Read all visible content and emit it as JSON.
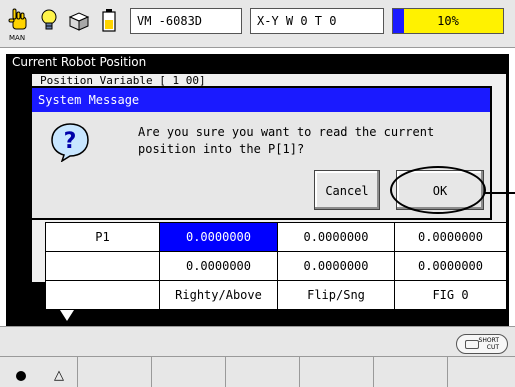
{
  "topbar": {
    "man_label": "MAN",
    "icons": [
      "hand-icon",
      "lightbulb-icon",
      "box-icon",
      "battery-icon"
    ],
    "program": "VM  -6083D",
    "coord_system": "X-Y  W 0 T 0",
    "speed_value": "10%",
    "speed_fraction": 0.1
  },
  "background_window": {
    "title": "Current Robot Position",
    "inner_title": "Position Variable [ 1 00]"
  },
  "dialog": {
    "title": "System Message",
    "icon": "question-icon",
    "message_line1": "Are you sure you want to read the current",
    "message_line2": "position into the P[1]?",
    "cancel_label": "Cancel",
    "ok_label": "OK"
  },
  "grid": {
    "rows": [
      [
        "P1",
        "0.0000000",
        "0.0000000",
        "0.0000000"
      ],
      [
        "",
        "0.0000000",
        "0.0000000",
        "0.0000000"
      ],
      [
        "",
        "Righty/Above",
        "Flip/Sng",
        "FIG  0"
      ]
    ]
  },
  "bottom": {
    "short_cut_top": "SHORT",
    "short_cut_bottom": "CUT",
    "fkey1": "●",
    "fkey2": "△"
  },
  "colors": {
    "title_blue": "#1a1aff",
    "selected_cell": "#0000ff",
    "speed_yellow": "#fff200",
    "panel_gray": "#e7e7e7"
  }
}
